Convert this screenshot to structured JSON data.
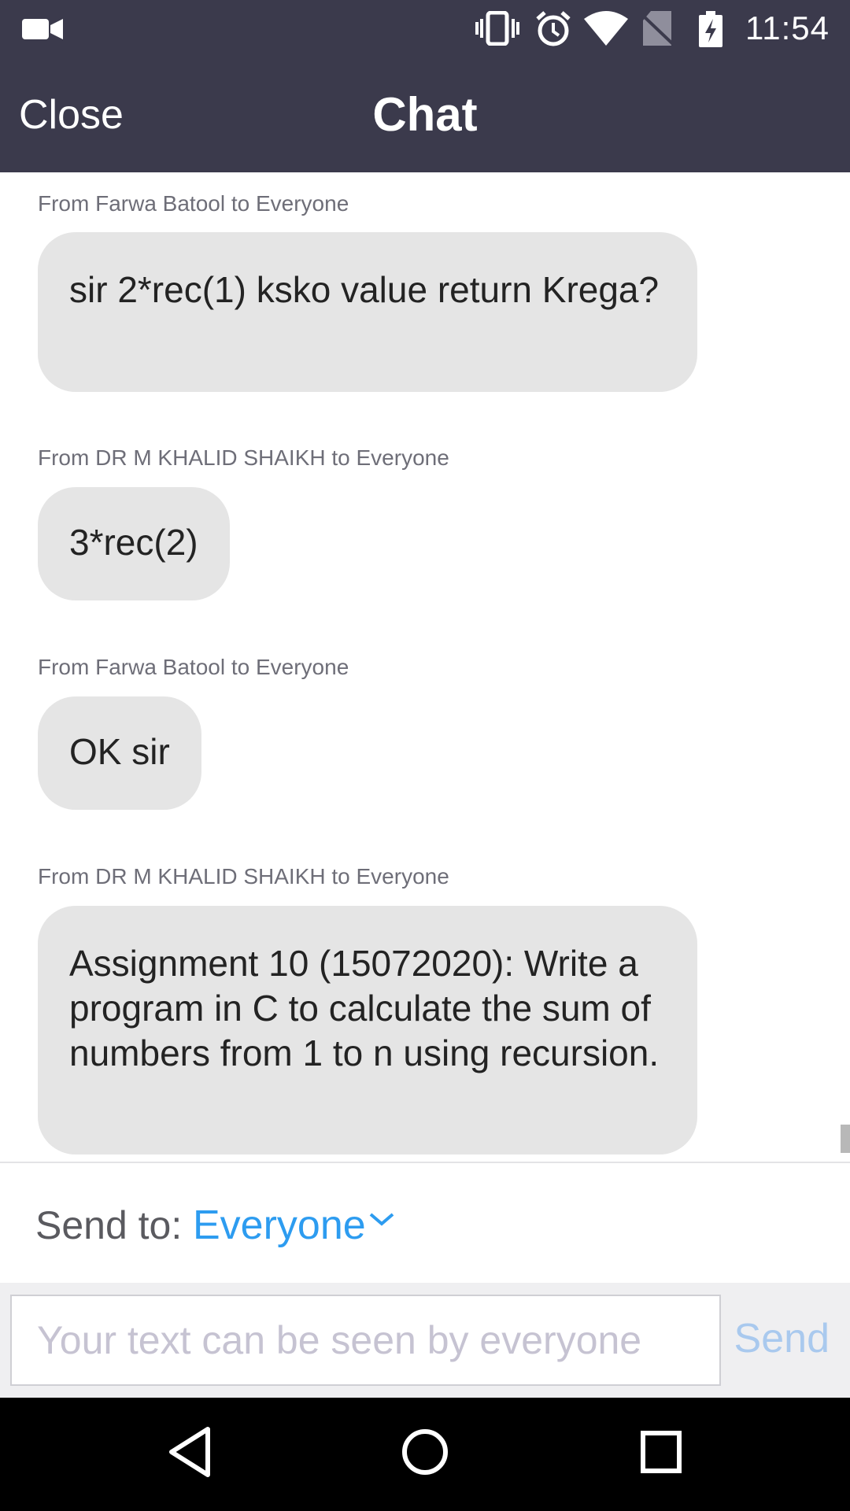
{
  "status_bar": {
    "time": "11:54",
    "icons": [
      "video-camera-icon",
      "vibrate-icon",
      "alarm-icon",
      "wifi-icon",
      "no-sim-icon",
      "battery-charging-icon"
    ]
  },
  "header": {
    "close_label": "Close",
    "title": "Chat"
  },
  "messages": [
    {
      "sender": "From Farwa Batool to Everyone",
      "text": "sir 2*rec(1) ksko value return Krega?"
    },
    {
      "sender": "From DR M KHALID SHAIKH to Everyone",
      "text": "3*rec(2)"
    },
    {
      "sender": "From Farwa Batool to Everyone",
      "text": "OK sir"
    },
    {
      "sender": "From DR M KHALID SHAIKH to Everyone",
      "text": "Assignment 10 (15072020): Write a program in C to calculate the sum of numbers from 1 to n using recursion."
    }
  ],
  "send_to": {
    "label": "Send to:",
    "value": "Everyone"
  },
  "composer": {
    "placeholder": "Your text can be seen by everyone",
    "send_label": "Send"
  },
  "nav": {
    "icons": [
      "back-icon",
      "home-icon",
      "recents-icon"
    ]
  },
  "colors": {
    "header_bg": "#3b3a4c",
    "bubble_bg": "#e5e5e5",
    "accent": "#2d9cf0",
    "send_disabled": "#a9c9ee"
  }
}
